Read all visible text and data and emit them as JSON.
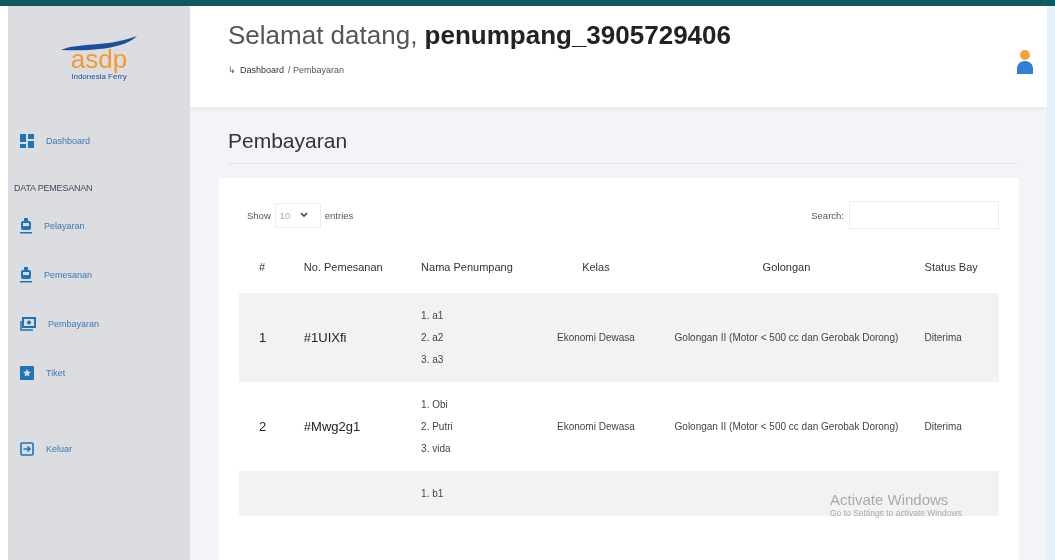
{
  "logo": {
    "name": "asdp",
    "tagline": "Indonesia Ferry"
  },
  "sidebar": {
    "items": [
      {
        "kind": "link",
        "label": "Dashboard"
      },
      {
        "kind": "heading",
        "label": "DATA PEMESANAN"
      },
      {
        "kind": "link",
        "label": "Pelayaran"
      },
      {
        "kind": "link",
        "label": "Pemesanan"
      },
      {
        "kind": "link",
        "label": "Pembayaran"
      },
      {
        "kind": "link",
        "label": "Tiket"
      },
      {
        "kind": "gap"
      },
      {
        "kind": "link",
        "label": "Keluar"
      }
    ]
  },
  "header": {
    "greeting": "Selamat datang,",
    "username": "penumpang_3905729406",
    "breadcrumb_arrow": "↳",
    "breadcrumb_link": "Dashboard",
    "breadcrumb_rest": "/ Pembayaran"
  },
  "page_title": "Pembayaran",
  "table_controls": {
    "show_label": "Show",
    "page_size": "10",
    "entries_label": "entries",
    "search_label": "Search:"
  },
  "table": {
    "columns": [
      "#",
      "No. Pemesanan",
      "Nama Penumpang",
      "Kelas",
      "Golongan",
      "Status Bay"
    ],
    "rows": [
      {
        "number": "1",
        "code": "#1UIXfi",
        "passengers": [
          "1. a1",
          "2. a2",
          "3. a3"
        ],
        "kelas": "Ekonomi Dewasa",
        "golongan": "Golongan II (Motor < 500 cc dan Gerobak Dorong)",
        "status": "Diterima"
      },
      {
        "number": "2",
        "code": "#Mwg2g1",
        "passengers": [
          "1. Obi",
          "2. Putri",
          "3. vida"
        ],
        "kelas": "Ekonomi Dewasa",
        "golongan": "Golongan II (Motor < 500 cc dan Gerobak Dorong)",
        "status": "Diterima"
      },
      {
        "passengers": [
          "1. b1"
        ]
      }
    ]
  },
  "os_notice": {
    "title": "Activate Windows",
    "subtitle": "Go to Settings to activate Windows."
  }
}
